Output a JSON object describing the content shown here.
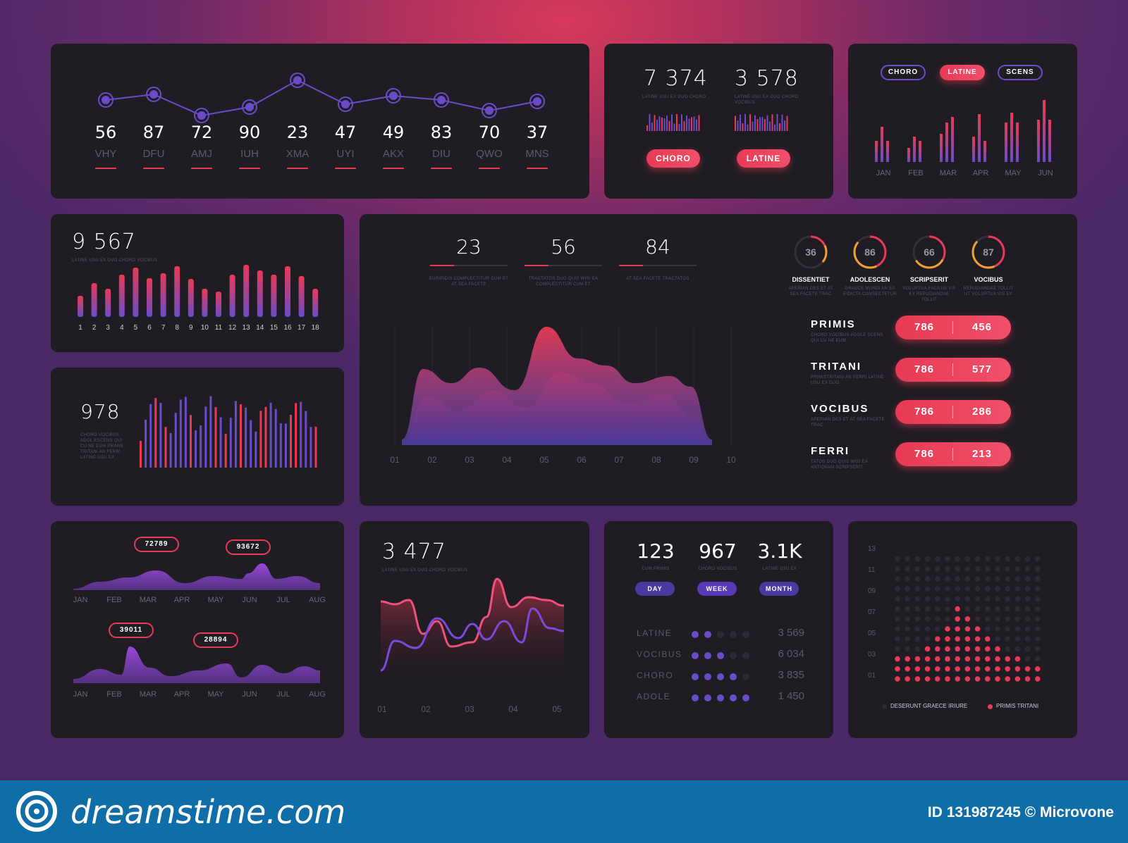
{
  "p1": {
    "values": [
      56,
      87,
      72,
      90,
      23,
      47,
      49,
      83,
      70,
      37
    ],
    "labels": [
      "VHY",
      "DFU",
      "AMJ",
      "IUH",
      "XMA",
      "UYI",
      "AKX",
      "DIU",
      "QWO",
      "MNS"
    ],
    "line": [
      60,
      68,
      38,
      50,
      88,
      54,
      66,
      60,
      45,
      58
    ]
  },
  "p2": {
    "num1": "7 374",
    "num2": "3 578",
    "sub1": "LATINE USU EX DUO CHORO",
    "sub2": "LATINE USU EX DUO CHORO VOCIBUS",
    "btn1": "CHORO",
    "btn2": "LATINE"
  },
  "p3": {
    "tabs": [
      "CHORO",
      "LATINE",
      "SCENS"
    ],
    "months": [
      "JAN",
      "FEB",
      "MAR",
      "APR",
      "MAY",
      "JUN"
    ]
  },
  "p4": {
    "number": "9 567",
    "sub": "LATINE USU EX DUO CHORO VOCIBUS",
    "labels": [
      "1",
      "2",
      "3",
      "4",
      "5",
      "6",
      "7",
      "8",
      "9",
      "10",
      "11",
      "12",
      "13",
      "14",
      "15",
      "16",
      "17",
      "18"
    ],
    "bars": [
      30,
      48,
      40,
      60,
      70,
      55,
      62,
      72,
      54,
      40,
      36,
      60,
      74,
      66,
      60,
      72,
      58,
      40
    ],
    "colors": {
      "a": "#e83a55",
      "b": "#6a4cc8"
    }
  },
  "p5": {
    "number": "978",
    "desc": "CHORO VOCIBUS ADOL ESCENS QUI CU NE EUM PRIMIS TRITANI AN FERRI LATINE USU EX"
  },
  "center": {
    "stats": [
      {
        "v": "23",
        "d": "EURIPIDIS COMPLECTITUR CUM ET AT SEA FACETE"
      },
      {
        "v": "56",
        "d": "TRACTATOS DUO QUIS WISI EA COMPLECTITUR CUM ET"
      },
      {
        "v": "84",
        "d": "AT SEA FACETE TRACTATOS"
      }
    ],
    "gauges": [
      {
        "v": "36",
        "name": "DISSENTIET",
        "d": "APERIAN DES ET AT SEA FACETE TRAC",
        "pct": 0.36
      },
      {
        "v": "86",
        "name": "ADOLESCEN",
        "d": "GRAECE MUNDI AN EA EIDICTA CONSECTETUR",
        "pct": 0.86
      },
      {
        "v": "66",
        "name": "SCRIPSERIT",
        "d": "VOLUPTUA FACILISI VIS EX REPUDIANDAE TOLLIT",
        "pct": 0.66
      },
      {
        "v": "87",
        "name": "VOCIBUS",
        "d": "REPUDIANDAE TOLLIT UT VOLUPTUA VIS EX",
        "pct": 0.87
      }
    ],
    "rows": [
      {
        "name": "PRIMIS",
        "d": "CHORO VOCIBUS ADOLE SCENS QUI CU NE EUM",
        "a": "786",
        "b": "456"
      },
      {
        "name": "TRITANI",
        "d": "PRIMISTRITANI AN FERRI LATINE USU EX DUO",
        "a": "786",
        "b": "577"
      },
      {
        "name": "VOCIBUS",
        "d": "APERIAN DES ET AT SEA FACETE TRAC",
        "a": "786",
        "b": "286"
      },
      {
        "name": "FERRI",
        "d": "TATOS DUO QUIS WISI EA ANTIOPAM SCRIPSERIT",
        "a": "786",
        "b": "213"
      }
    ],
    "xlabels": [
      "01",
      "02",
      "03",
      "04",
      "05",
      "06",
      "07",
      "08",
      "09",
      "10"
    ]
  },
  "p6": {
    "tags": [
      "72789",
      "93672",
      "39011",
      "28894"
    ],
    "months": [
      "JAN",
      "FEB",
      "MAR",
      "APR",
      "MAY",
      "JUN",
      "JUL",
      "AUG"
    ]
  },
  "p7": {
    "number": "3 477",
    "sub": "LATINE USU EX DUO CHORO VOCIBUS",
    "xlabels": [
      "01",
      "02",
      "03",
      "04",
      "05"
    ]
  },
  "p8": {
    "nums": [
      {
        "v": "123",
        "d": "CUM PRIMIS"
      },
      {
        "v": "967",
        "d": "CHORO VOCIBUS"
      },
      {
        "v": "3.1K",
        "d": "LATINE USU EX"
      }
    ],
    "tabs": [
      "DAY",
      "WEEK",
      "MONTH"
    ],
    "rows": [
      {
        "label": "LATINE",
        "dots": 2,
        "v": "3 569"
      },
      {
        "label": "VOCIBUS",
        "dots": 3,
        "v": "6 034"
      },
      {
        "label": "CHORO",
        "dots": 4,
        "v": "3 835"
      },
      {
        "label": "ADOLE",
        "dots": 5,
        "v": "1 450"
      }
    ]
  },
  "p9": {
    "ylabels": [
      "13",
      "11",
      "09",
      "07",
      "05",
      "03",
      "01"
    ],
    "legend1": "DESERUNT GRAECE IRIURE",
    "legend2": "PRIMIS TRITANI",
    "heights": [
      3,
      3,
      3,
      4,
      5,
      6,
      8,
      7,
      6,
      5,
      4,
      3,
      3,
      2,
      2
    ]
  },
  "footer": {
    "brand": "dreamstime.com",
    "id": "ID 131987245 © Microvone"
  }
}
